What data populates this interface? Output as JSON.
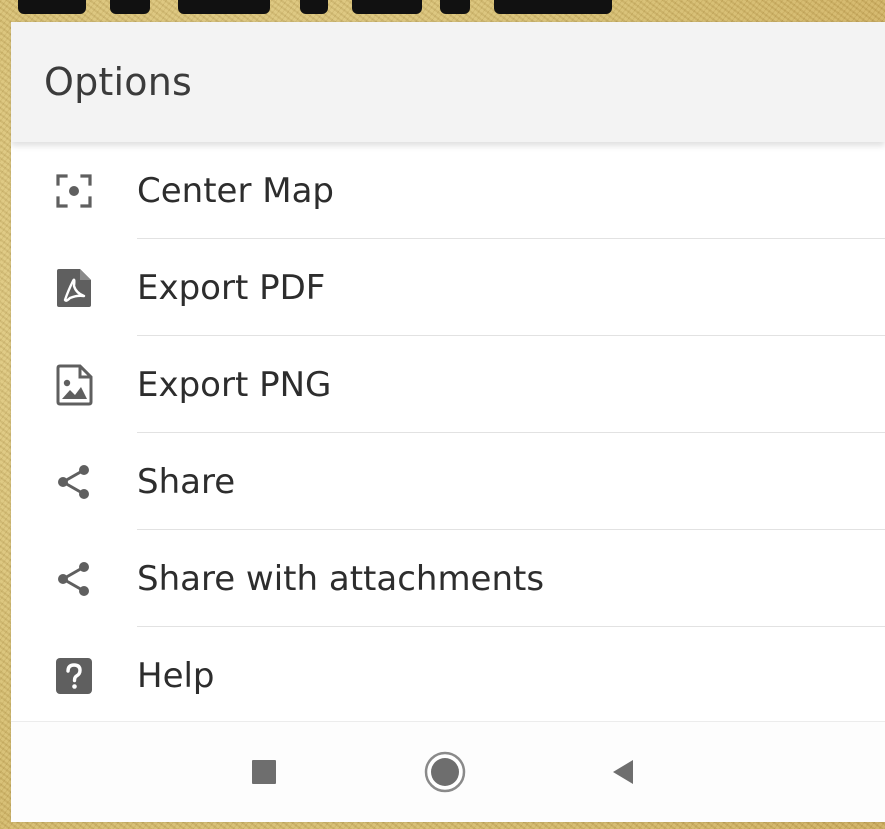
{
  "sheet": {
    "title": "Options"
  },
  "menu": {
    "items": [
      {
        "label": "Center Map",
        "icon": "center-focus-icon"
      },
      {
        "label": "Export PDF",
        "icon": "pdf-file-icon"
      },
      {
        "label": "Export PNG",
        "icon": "image-file-icon"
      },
      {
        "label": "Share",
        "icon": "share-icon"
      },
      {
        "label": "Share with attachments",
        "icon": "share-icon"
      },
      {
        "label": "Help",
        "icon": "help-icon"
      }
    ]
  },
  "navbar": {
    "buttons": [
      {
        "icon": "recents-square-icon"
      },
      {
        "icon": "home-circle-icon"
      },
      {
        "icon": "back-triangle-icon"
      }
    ]
  },
  "colors": {
    "background_border": "#d9c47f",
    "sheet_background": "#ffffff",
    "header_background": "#f3f3f3",
    "icon_gray": "#5f5f5f",
    "text": "#2d2d2d"
  }
}
